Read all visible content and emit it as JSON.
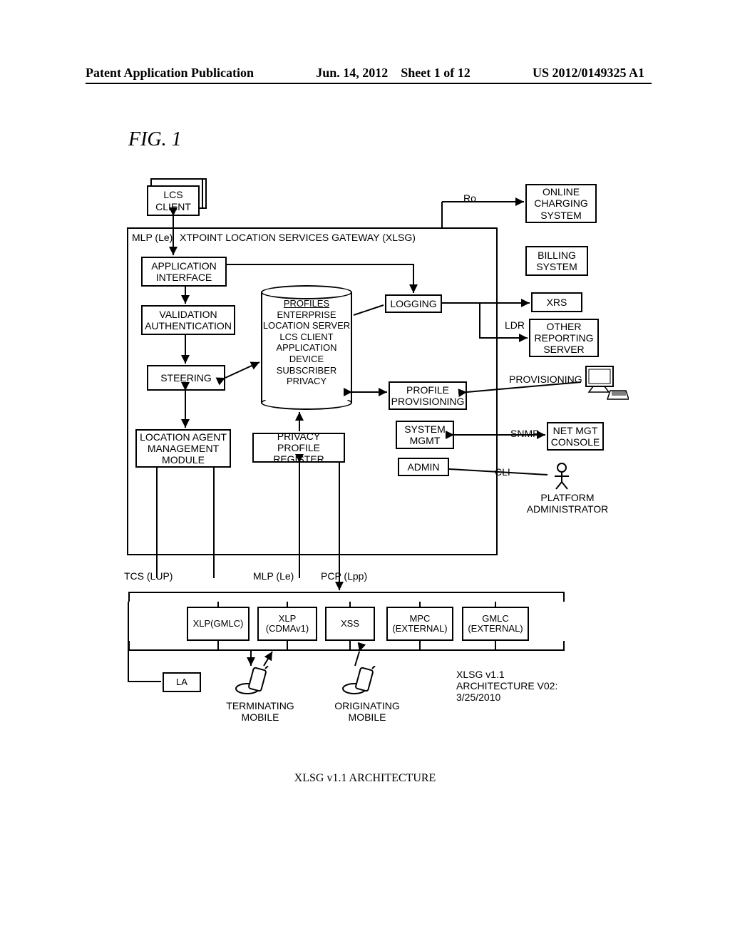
{
  "header": {
    "left": "Patent Application Publication",
    "date": "Jun. 14, 2012",
    "sheet": "Sheet 1 of 12",
    "pubno": "US 2012/0149325 A1"
  },
  "figLabel": "FIG.  1",
  "xlsgTitle": "XTPOINT LOCATION SERVICES GATEWAY (XLSG)",
  "lcsClient": "LCS CLIENT",
  "mlp": "MLP (Le)",
  "appIf": "APPLICATION INTERFACE",
  "valAuth": "VALIDATION AUTHENTICATION",
  "steering": "STEERING",
  "lamm": "LOCATION AGENT MANAGEMENT MODULE",
  "ppr": "PRIVACY PROFILE REGISTER",
  "profiles": {
    "title": "PROFILES",
    "lines": "ENTERPRISE\nLOCATION SERVER\nLCS CLIENT\nAPPLICATION\nDEVICE\nSUBSCRIBER\nPRIVACY"
  },
  "logging": "LOGGING",
  "profProv": "PROFILE PROVISIONING",
  "sysmgmt": "SYSTEM MGMT",
  "admin": "ADMIN",
  "ro": "Ro",
  "ocs": "ONLINE CHARGING SYSTEM",
  "billing": "BILLING SYSTEM",
  "xrs": "XRS",
  "ldr": "LDR",
  "otherRpt": "OTHER REPORTING SERVER",
  "prov": "PROVISIONING",
  "snmp": "SNMP",
  "netmgt": "NET MGT CONSOLE",
  "cli": "CLI",
  "platAdmin": "PLATFORM ADMINISTRATOR",
  "tcs": "TCS (LUP)",
  "mlpLe": "MLP (Le)",
  "pcp": "PCP (Lpp)",
  "row": {
    "xlpGmlc": "XLP(GMLC)",
    "xlpCdma": "XLP (CDMAv1)",
    "xss": "XSS",
    "mpc": "MPC (EXTERNAL)",
    "gmlc": "GMLC (EXTERNAL)"
  },
  "la": "LA",
  "termMobile": "TERMINATING MOBILE",
  "origMobile": "ORIGINATING MOBILE",
  "archNote": "XLSG v1.1 ARCHITECTURE V02: 3/25/2010",
  "bottomCaption": "XLSG v1.1 ARCHITECTURE"
}
